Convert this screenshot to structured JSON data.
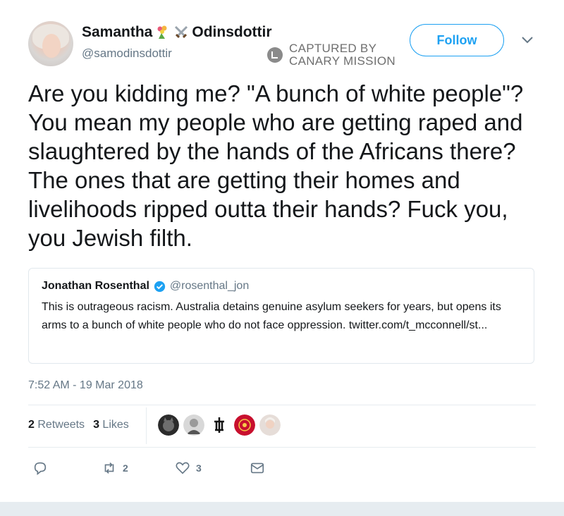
{
  "author": {
    "name_first": "Samantha",
    "name_last": "Odinsdottir",
    "name_emojis": [
      "bouquet-icon",
      "crossed-swords-icon"
    ],
    "handle": "@samodinsdottir"
  },
  "watermark": {
    "line1": "CAPTURED BY",
    "line2": "CANARY MISSION"
  },
  "follow_label": "Follow",
  "tweet_text": "Are you kidding me? \"A bunch of white people\"? You mean my people who are getting raped and slaughtered by the hands of the Africans there? The ones that are getting their homes and livelihoods ripped outta their hands? Fuck you, you Jewish filth.",
  "quoted": {
    "name": "Jonathan Rosenthal",
    "handle": "@rosenthal_jon",
    "text": "This is outrageous racism. Australia detains genuine asylum seekers for years, but opens its arms to a bunch of white people who do not face oppression. twitter.com/t_mcconnell/st..."
  },
  "timestamp": "7:52 AM - 19 Mar 2018",
  "stats": {
    "retweets_count": "2",
    "retweets_label": "Retweets",
    "likes_count": "3",
    "likes_label": "Likes"
  },
  "likers": [
    "cat-avatar",
    "man-avatar",
    "symbol-avatar",
    "red-pattern-avatar",
    "woman-avatar"
  ],
  "actions": {
    "reply_count": "",
    "retweet_count": "2",
    "like_count": "3"
  },
  "colors": {
    "accent": "#1da1f2",
    "muted": "#657786",
    "text": "#14171a",
    "divider": "#e6ecf0"
  }
}
